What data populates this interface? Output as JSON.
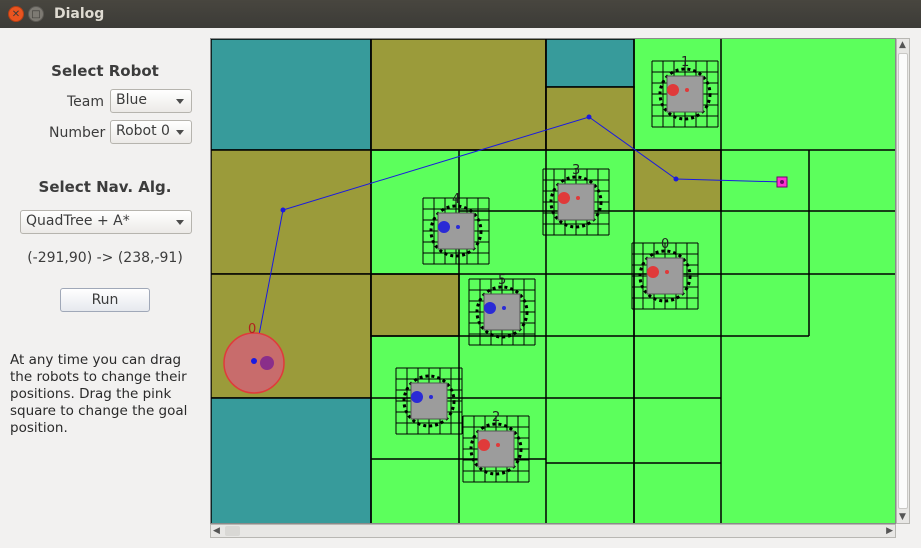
{
  "window": {
    "title": "Dialog",
    "close_glyph": "✕",
    "max_glyph": "□"
  },
  "robot_select": {
    "heading": "Select Robot",
    "team_label": "Team",
    "team_value": "Blue",
    "number_label": "Number",
    "number_value": "Robot 0"
  },
  "nav": {
    "heading": "Select Nav. Alg.",
    "algorithm_value": "QuadTree + A*",
    "path_coords": "(-291,90) -> (238,-91)"
  },
  "run_button": "Run",
  "info_text": "At any time you can drag the robots to change their positions. Drag the pink square to change the goal position.",
  "field": {
    "colors": {
      "free": "#5cff5c",
      "partial": "#9b9b3a",
      "blocked": "#379b9b",
      "obstacle_gray": "#9c9c9c",
      "red_team": "#e03a3a",
      "blue_team": "#2a2ad6",
      "path": "#1a1ae0",
      "goal": "#ff30d0",
      "selected_fill": "#c86c6c",
      "selected_ring": "#e03a3a"
    },
    "robot_labels": [
      "0",
      "1",
      "2",
      "3",
      "4",
      "5",
      "0"
    ]
  },
  "scrollbars": {
    "left_arrow": "◀",
    "right_arrow": "▶",
    "up_arrow": "▲",
    "down_arrow": "▼"
  }
}
